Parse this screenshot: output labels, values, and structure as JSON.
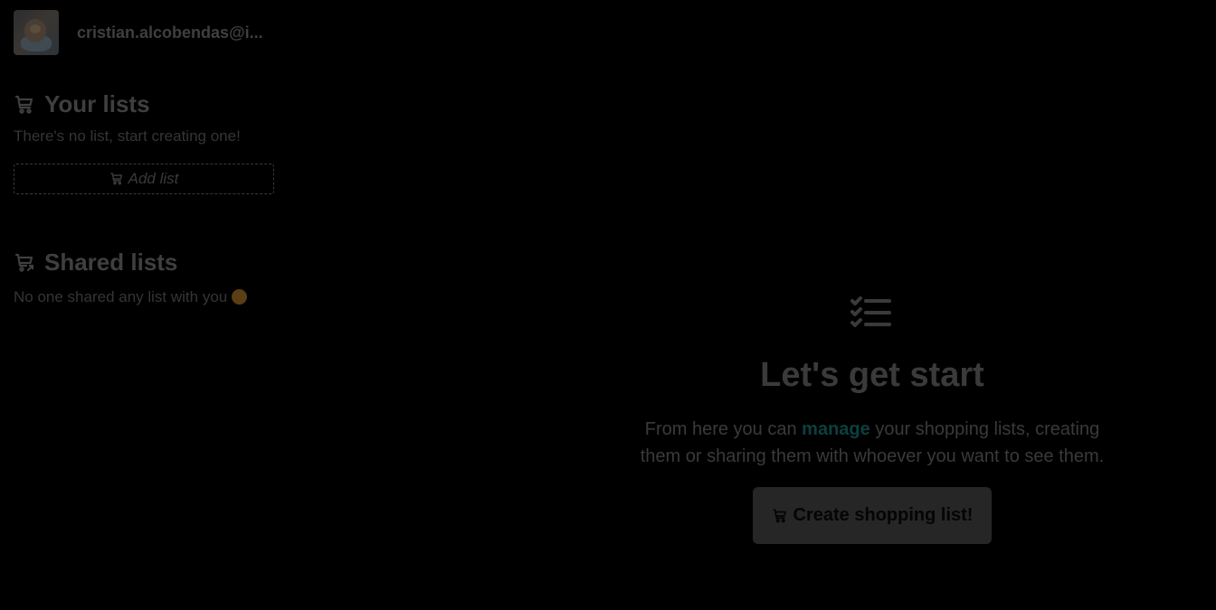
{
  "user": {
    "email": "cristian.alcobendas@i...",
    "avatar_icon": "avatar"
  },
  "sidebar": {
    "your_lists": {
      "title": "Your lists",
      "icon": "shopping-cart-icon",
      "empty_text": "There's no list, start creating one!",
      "add_button_label": "Add list"
    },
    "shared_lists": {
      "title": "Shared lists",
      "icon": "shared-cart-icon",
      "empty_text": "No one shared any list with you",
      "emoji": "sad-face-emoji"
    }
  },
  "main": {
    "icon": "checklist-icon",
    "title": "Let's get start",
    "description_before": "From here you can ",
    "description_accent": "manage",
    "description_after": " your shopping lists, creating them or sharing them with whoever you want to see them.",
    "create_button_label": "Create shopping list!"
  },
  "colors": {
    "background": "#000000",
    "accent": "#0d3f3f",
    "button_bg": "#262626",
    "text_muted": "#3a3a3a"
  }
}
